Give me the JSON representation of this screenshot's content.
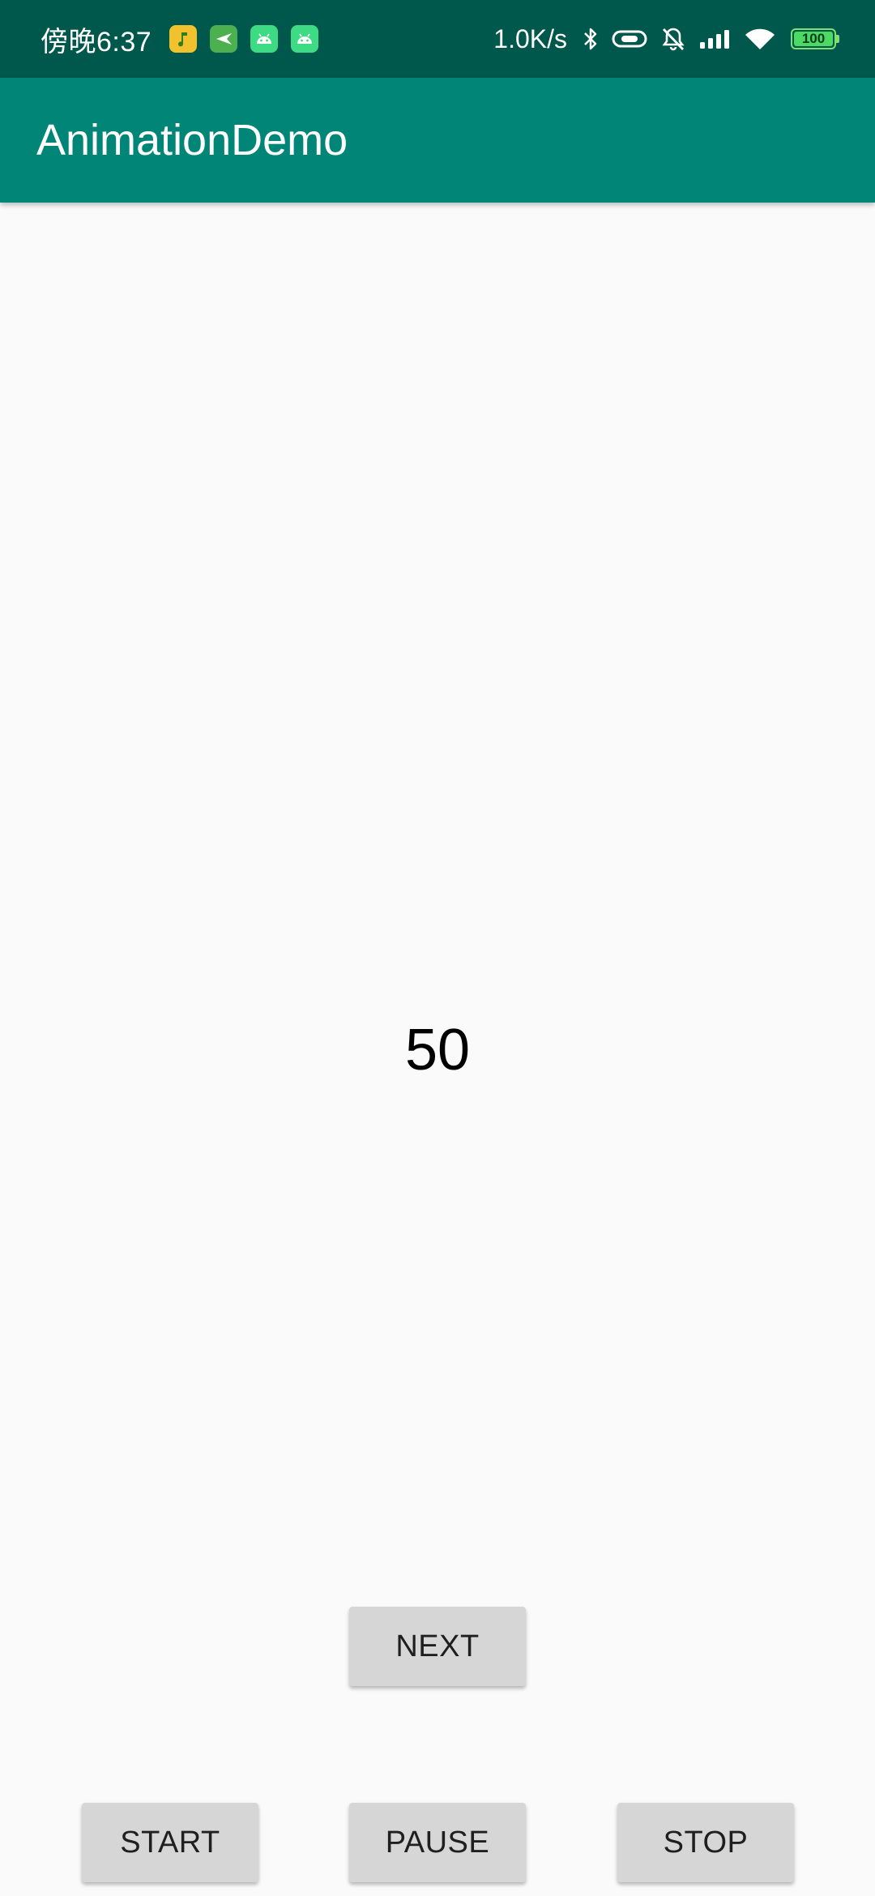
{
  "status_bar": {
    "time": "傍晚6:37",
    "network_speed": "1.0K/s",
    "battery_level": "100",
    "notification_icons": [
      "music-icon",
      "send-icon",
      "android-icon",
      "android-icon"
    ],
    "colors": {
      "background": "#00574b"
    }
  },
  "app_bar": {
    "title": "AnimationDemo",
    "colors": {
      "background": "#008577",
      "text": "#ffffff"
    }
  },
  "main": {
    "counter_value": "50"
  },
  "buttons": {
    "next": "NEXT",
    "start": "START",
    "pause": "PAUSE",
    "stop": "STOP"
  }
}
